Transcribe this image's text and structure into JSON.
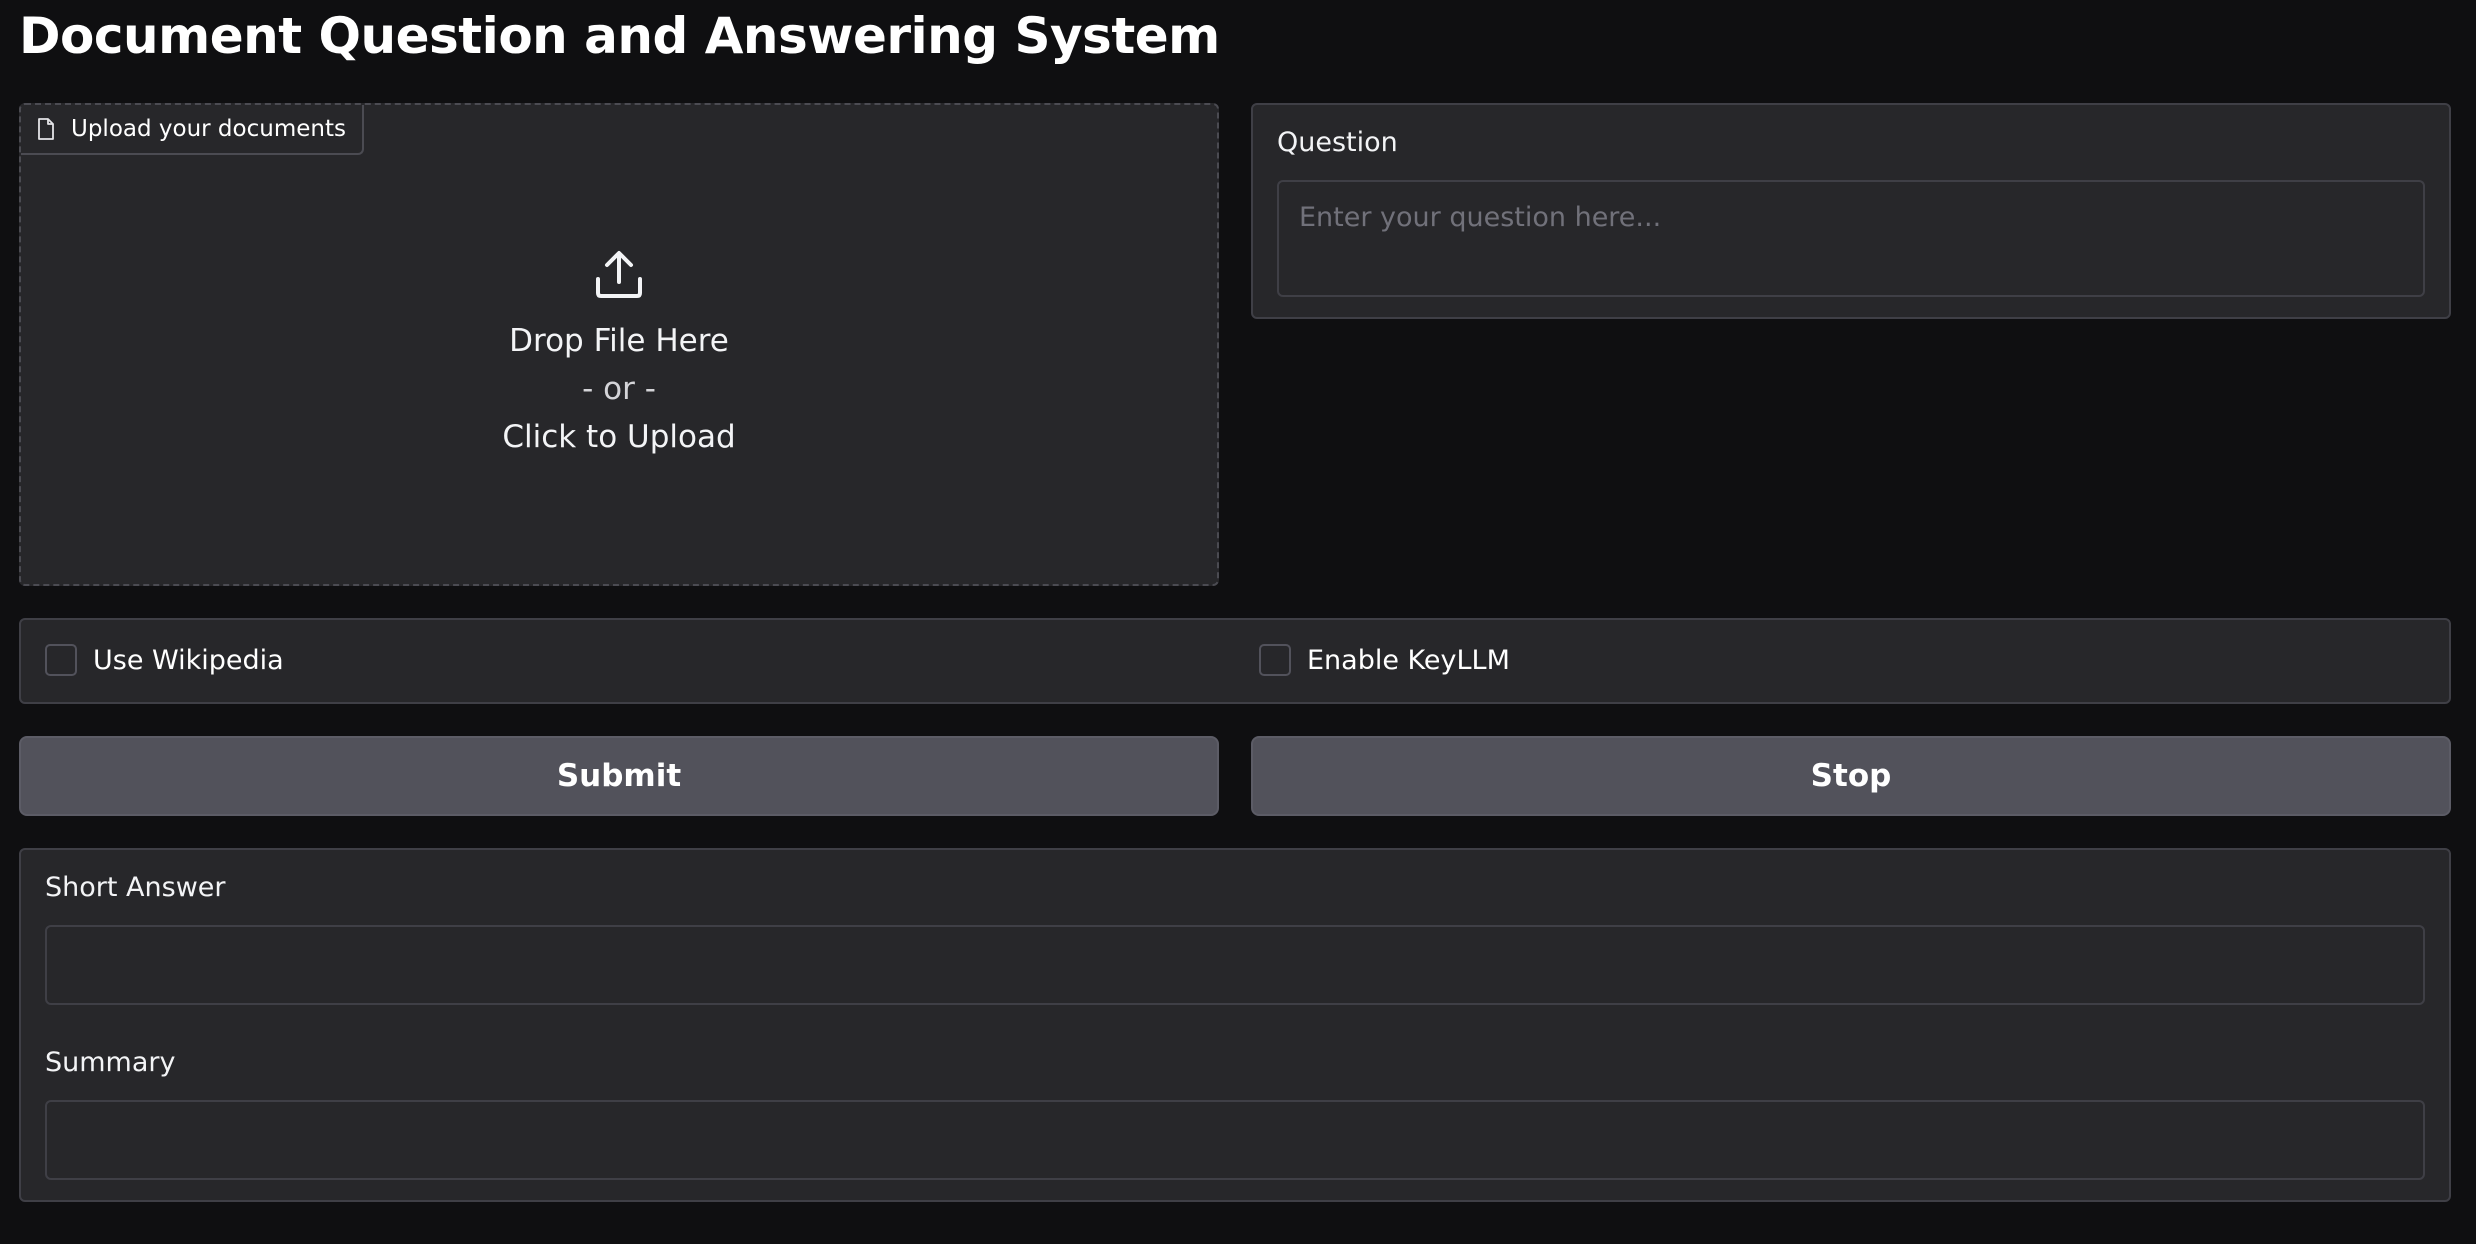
{
  "app": {
    "title": "Document Question and Answering System"
  },
  "upload": {
    "tag_label": "Upload your documents",
    "drop_text": "Drop File Here",
    "or_text": "- or -",
    "click_text": "Click to Upload"
  },
  "question": {
    "label": "Question",
    "placeholder": "Enter your question here...",
    "value": ""
  },
  "options": {
    "use_wikipedia": {
      "label": "Use Wikipedia",
      "checked": false
    },
    "enable_keyllm": {
      "label": "Enable KeyLLM",
      "checked": false
    }
  },
  "actions": {
    "submit_label": "Submit",
    "stop_label": "Stop"
  },
  "outputs": {
    "short_answer": {
      "label": "Short Answer",
      "value": ""
    },
    "summary": {
      "label": "Summary",
      "value": ""
    }
  },
  "colors": {
    "background": "#0f0f11",
    "panel": "#27272a",
    "border": "#3f3f46",
    "button": "#52525b",
    "text": "#f3f4f6"
  },
  "icons": {
    "upload_tag_icon": "file-icon",
    "upload_area_icon": "upload-icon"
  }
}
